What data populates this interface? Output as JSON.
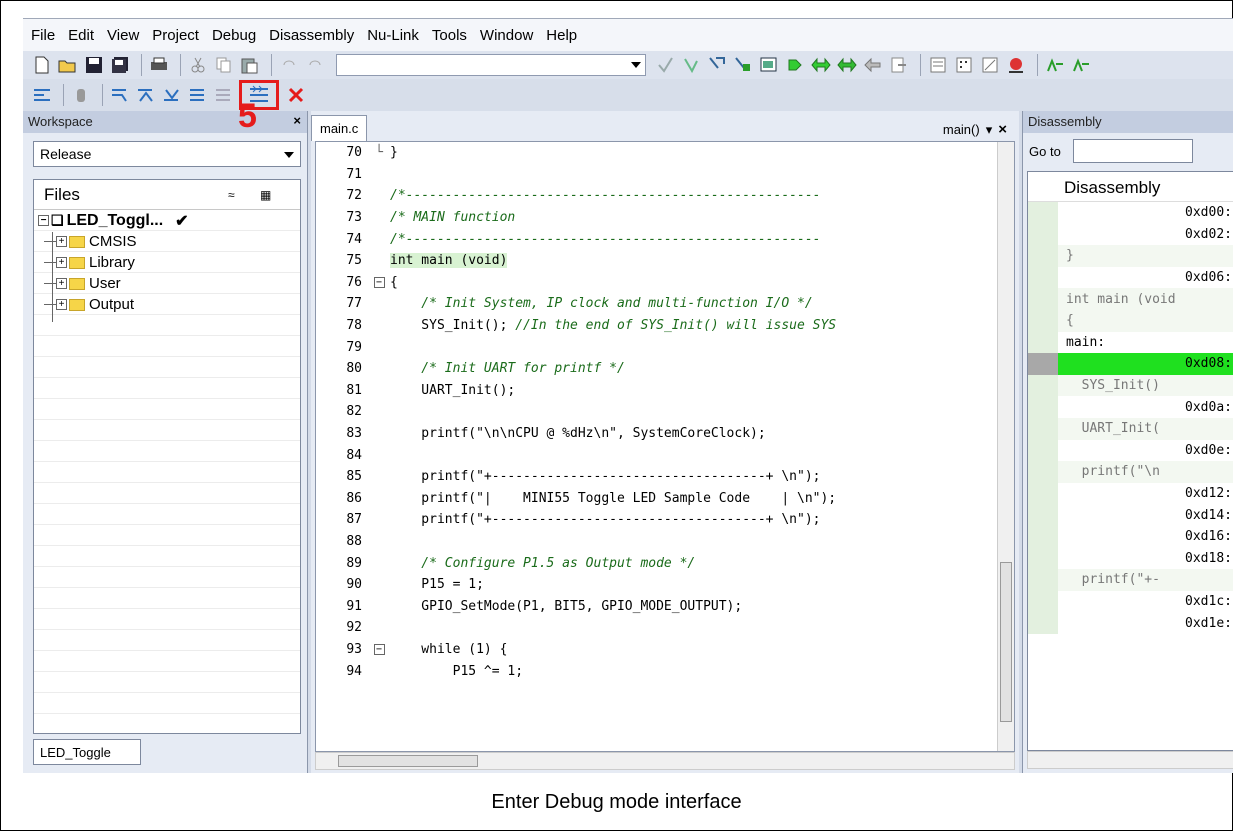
{
  "menu": [
    "File",
    "Edit",
    "View",
    "Project",
    "Debug",
    "Disassembly",
    "Nu-Link",
    "Tools",
    "Window",
    "Help"
  ],
  "step_marker": "5",
  "workspace": {
    "title": "Workspace",
    "close": "×",
    "config": "Release",
    "files_header": "Files",
    "project": "LED_Toggl...",
    "project_check": "✔",
    "folders": [
      "CMSIS",
      "Library",
      "User",
      "Output"
    ],
    "tab": "LED_Toggle"
  },
  "editor": {
    "tab": "main.c",
    "function": "main()",
    "close": "×",
    "lines": [
      {
        "n": "70",
        "fold": "end",
        "text": "}",
        "kind": "code"
      },
      {
        "n": "71",
        "fold": "",
        "text": "",
        "kind": "code"
      },
      {
        "n": "72",
        "fold": "",
        "text": "/*-----------------------------------------------------",
        "kind": "cmt"
      },
      {
        "n": "73",
        "fold": "",
        "text": "/* MAIN function",
        "kind": "cmt"
      },
      {
        "n": "74",
        "fold": "",
        "text": "/*-----------------------------------------------------",
        "kind": "cmt"
      },
      {
        "n": "75",
        "fold": "",
        "text": "int main (void)",
        "kind": "code",
        "current": true
      },
      {
        "n": "76",
        "fold": "box",
        "text": "{",
        "kind": "code"
      },
      {
        "n": "77",
        "fold": "",
        "text": "    /* Init System, IP clock and multi-function I/O */",
        "kind": "cmt"
      },
      {
        "n": "78",
        "fold": "",
        "text": "    SYS_Init(); //In the end of SYS_Init() will issue SYS",
        "kind": "mixed"
      },
      {
        "n": "79",
        "fold": "",
        "text": "",
        "kind": "code"
      },
      {
        "n": "80",
        "fold": "",
        "text": "    /* Init UART for printf */",
        "kind": "cmt"
      },
      {
        "n": "81",
        "fold": "",
        "text": "    UART_Init();",
        "kind": "code"
      },
      {
        "n": "82",
        "fold": "",
        "text": "",
        "kind": "code"
      },
      {
        "n": "83",
        "fold": "",
        "text": "    printf(\"\\n\\nCPU @ %dHz\\n\", SystemCoreClock);",
        "kind": "code"
      },
      {
        "n": "84",
        "fold": "",
        "text": "",
        "kind": "code"
      },
      {
        "n": "85",
        "fold": "",
        "text": "    printf(\"+-----------------------------------+ \\n\");",
        "kind": "code"
      },
      {
        "n": "86",
        "fold": "",
        "text": "    printf(\"|    MINI55 Toggle LED Sample Code    | \\n\");",
        "kind": "code"
      },
      {
        "n": "87",
        "fold": "",
        "text": "    printf(\"+-----------------------------------+ \\n\");",
        "kind": "code"
      },
      {
        "n": "88",
        "fold": "",
        "text": "",
        "kind": "code"
      },
      {
        "n": "89",
        "fold": "",
        "text": "    /* Configure P1.5 as Output mode */",
        "kind": "cmt"
      },
      {
        "n": "90",
        "fold": "",
        "text": "    P15 = 1;",
        "kind": "code"
      },
      {
        "n": "91",
        "fold": "",
        "text": "    GPIO_SetMode(P1, BIT5, GPIO_MODE_OUTPUT);",
        "kind": "code"
      },
      {
        "n": "92",
        "fold": "",
        "text": "",
        "kind": "code"
      },
      {
        "n": "93",
        "fold": "box",
        "text": "    while (1) {",
        "kind": "code"
      },
      {
        "n": "94",
        "fold": "",
        "text": "        P15 ^= 1;",
        "kind": "code"
      }
    ],
    "code_prefix_78": "    SYS_Init(); ",
    "code_comment_78": "//In the end of SYS_Init() will issue SYS"
  },
  "disassembly": {
    "title": "Disassembly",
    "goto_label": "Go to",
    "header": "Disassembly",
    "rows": [
      {
        "text": "0xd00:",
        "kind": "addr"
      },
      {
        "text": "0xd02:",
        "kind": "addr"
      },
      {
        "text": "}",
        "kind": "src"
      },
      {
        "text": "0xd06:",
        "kind": "addr"
      },
      {
        "text": "int main (void",
        "kind": "src"
      },
      {
        "text": "{",
        "kind": "src"
      },
      {
        "text": "main:",
        "kind": "lbl"
      },
      {
        "text": "0xd08:",
        "kind": "addr",
        "current": true
      },
      {
        "text": "  SYS_Init()",
        "kind": "src"
      },
      {
        "text": "0xd0a:",
        "kind": "addr"
      },
      {
        "text": "  UART_Init(",
        "kind": "src"
      },
      {
        "text": "0xd0e:",
        "kind": "addr"
      },
      {
        "text": "  printf(\"\\n",
        "kind": "src"
      },
      {
        "text": "0xd12:",
        "kind": "addr"
      },
      {
        "text": "0xd14:",
        "kind": "addr"
      },
      {
        "text": "0xd16:",
        "kind": "addr"
      },
      {
        "text": "0xd18:",
        "kind": "addr"
      },
      {
        "text": "  printf(\"+-",
        "kind": "src"
      },
      {
        "text": "0xd1c:",
        "kind": "addr"
      },
      {
        "text": "0xd1e:",
        "kind": "addr"
      }
    ]
  },
  "caption": "Enter Debug mode interface",
  "colors": {
    "highlight_red": "#e51b1b",
    "current_line_green": "#1fe01f",
    "comment_green": "#1a6b1a"
  }
}
